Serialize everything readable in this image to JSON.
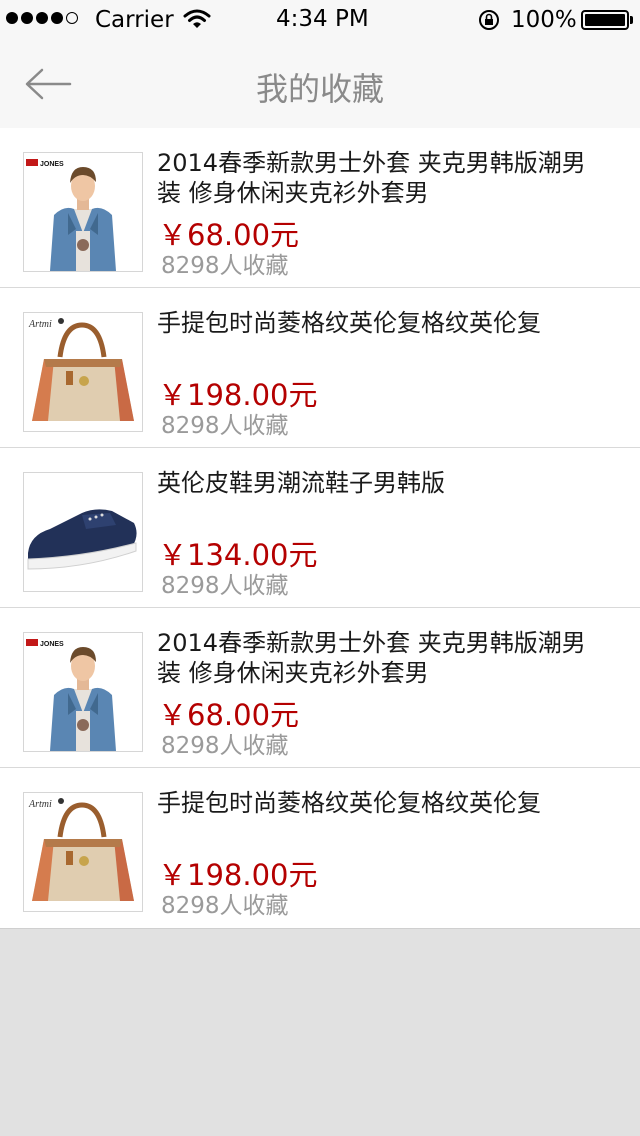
{
  "status_bar": {
    "carrier": "Carrier",
    "time": "4:34 PM",
    "battery": "100%"
  },
  "nav": {
    "title": "我的收藏"
  },
  "items": [
    {
      "title": "2014春季新款男士外套 夹克男韩版潮男装 修身休闲夹克衫外套男",
      "price": "￥68.00元",
      "count": "8298人收藏",
      "brand": "JONES",
      "image": "denim-jacket-man"
    },
    {
      "title": "手提包时尚菱格纹英伦复格纹英伦复",
      "price": "￥198.00元",
      "count": "8298人收藏",
      "brand": "Artmi",
      "image": "tan-handbag"
    },
    {
      "title": "英伦皮鞋男潮流鞋子男韩版",
      "price": "￥134.00元",
      "count": "8298人收藏",
      "image": "navy-suede-shoe"
    },
    {
      "title": "2014春季新款男士外套 夹克男韩版潮男装 修身休闲夹克衫外套男",
      "price": "￥68.00元",
      "count": "8298人收藏",
      "brand": "JONES",
      "image": "denim-jacket-man"
    },
    {
      "title": "手提包时尚菱格纹英伦复格纹英伦复",
      "price": "￥198.00元",
      "count": "8298人收藏",
      "brand": "Artmi",
      "image": "tan-handbag"
    }
  ],
  "colors": {
    "price": "#b40000",
    "count": "#9a9a9a",
    "title": "#8a8a8a",
    "bar": "#f7f7f7",
    "background": "#e1e1e1"
  }
}
